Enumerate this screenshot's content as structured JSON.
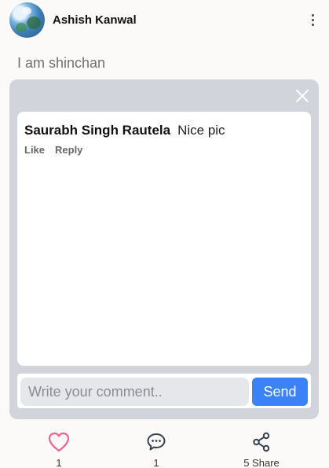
{
  "post": {
    "author": "Ashish Kanwal",
    "caption": "I am shinchan"
  },
  "modal": {
    "comments": [
      {
        "author": "Saurabh Singh Rautela",
        "text": "Nice pic",
        "like_label": "Like",
        "reply_label": "Reply"
      }
    ],
    "input_placeholder": "Write your comment..",
    "send_label": "Send"
  },
  "actions": {
    "like_count": "1",
    "comment_count": "1",
    "share_label": "5 Share"
  },
  "icons": {
    "more": "vertical-ellipsis-icon",
    "close": "close-icon",
    "like": "heart-icon",
    "comment": "chat-bubble-icon",
    "share": "share-icon"
  },
  "colors": {
    "accent": "#3b82f6",
    "heart": "#f06292",
    "modal_overlay": "#d1d5db"
  }
}
